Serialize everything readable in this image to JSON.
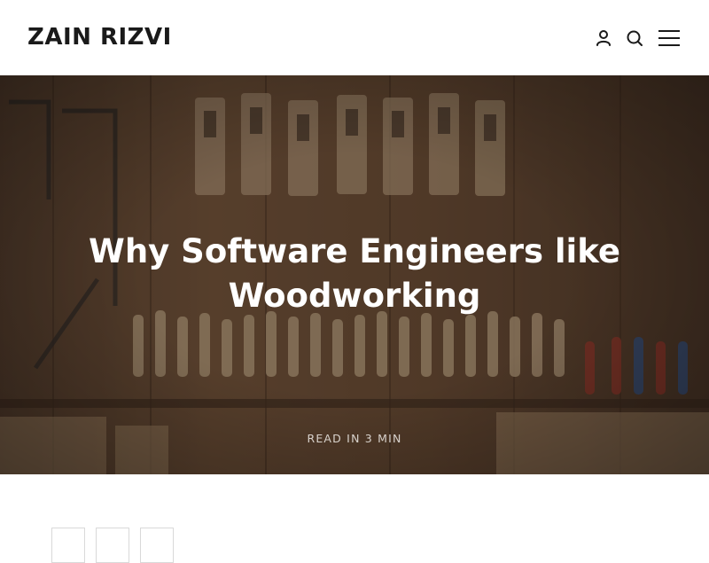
{
  "site": {
    "title": "ZAIN RIZVI"
  },
  "header": {
    "icons": [
      "user-icon",
      "search-icon",
      "menu-icon"
    ]
  },
  "hero": {
    "title": "Why Software Engineers like Woodworking",
    "read_time": "READ IN 3 MIN"
  },
  "share": {
    "icons": [
      "share-button-1",
      "share-button-2",
      "share-button-3"
    ]
  },
  "colors": {
    "text_dark": "#1a1a1a",
    "hero_overlay": "#2b1d14",
    "white": "#ffffff"
  }
}
